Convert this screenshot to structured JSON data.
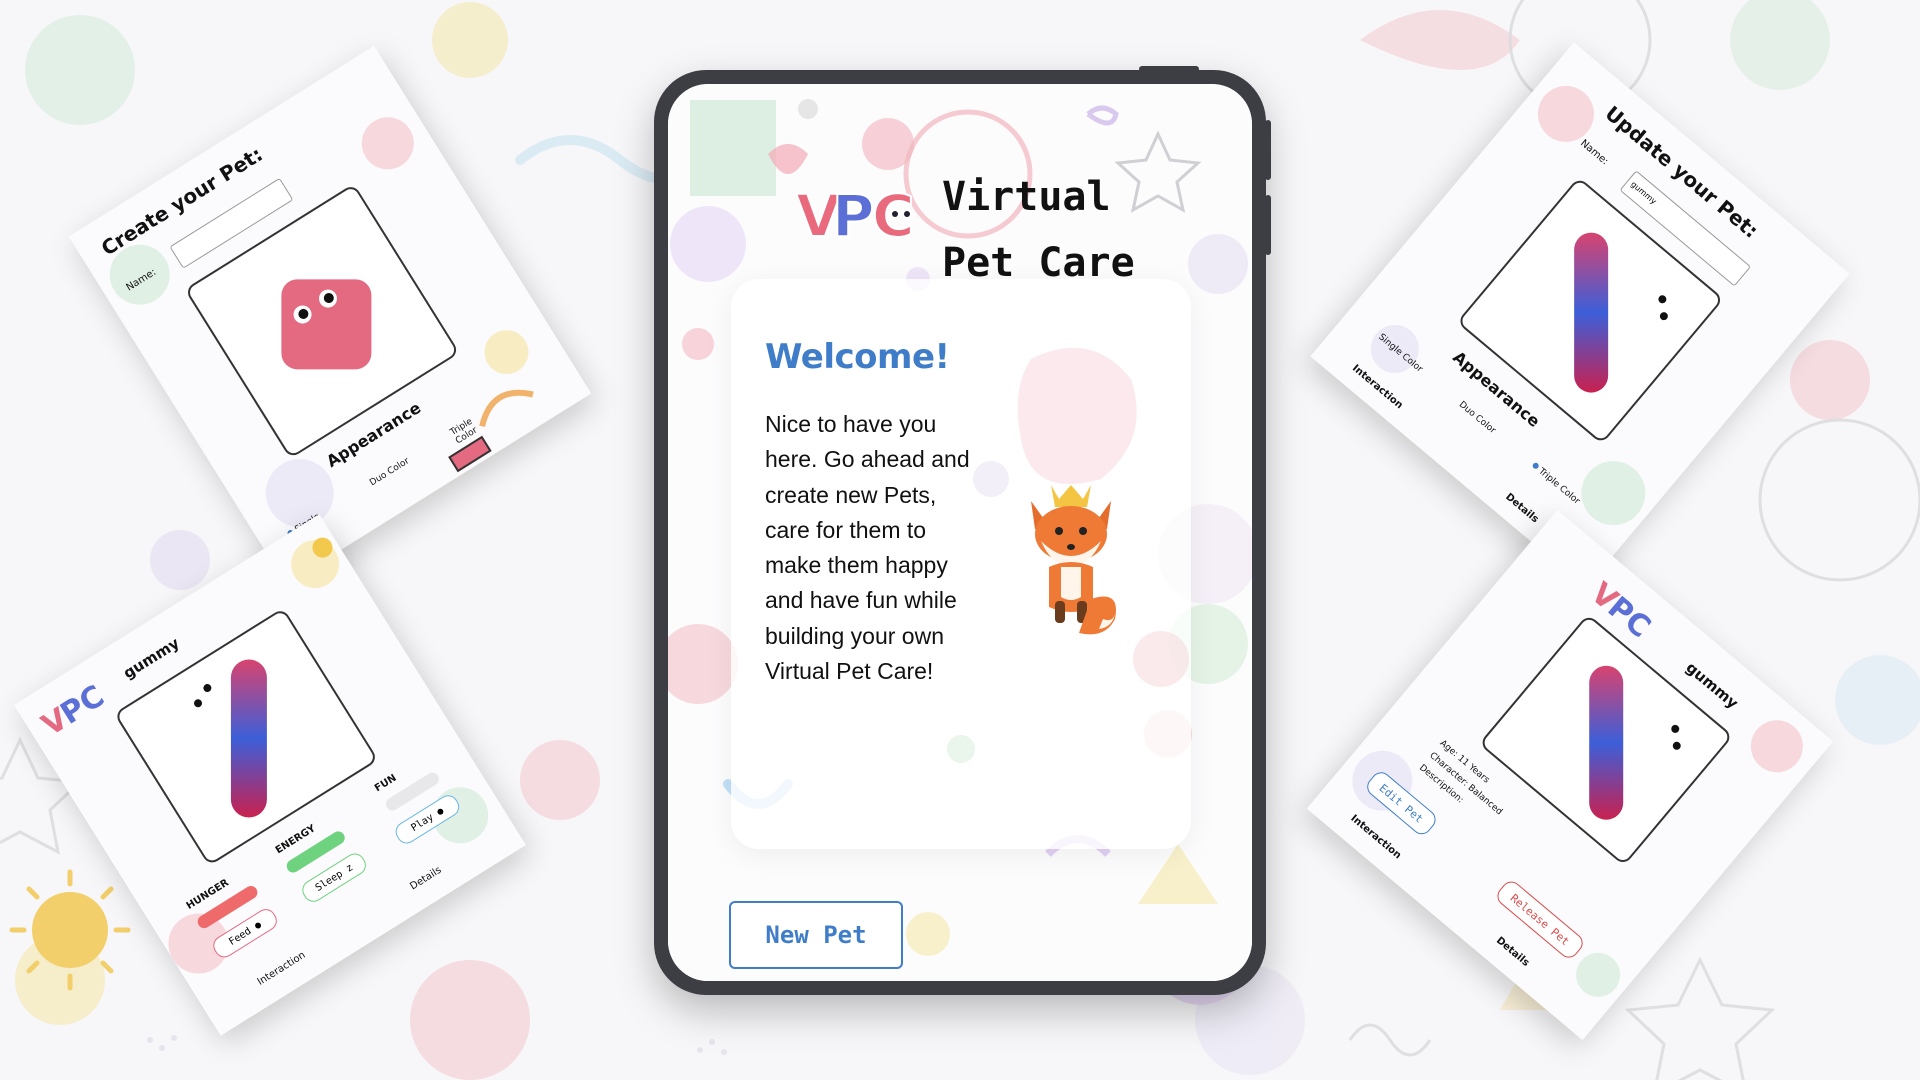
{
  "app": {
    "title_line1": "Virtual",
    "title_line2": "Pet Care",
    "logo_text": "VPC"
  },
  "welcome": {
    "heading": "Welcome!",
    "body": "Nice to have you here. Go ahead and create new Pets, care for them to make them happy and have fun while building your own Virtual Pet Care!",
    "new_pet_label": "New Pet"
  },
  "create_screen": {
    "title": "Create your Pet:",
    "name_label": "Name:",
    "appearance_heading": "Appearance",
    "options": [
      "Single Color",
      "Duo Color",
      "Triple Color"
    ]
  },
  "care_screen": {
    "pet_name": "gummy",
    "stats": [
      "HUNGER",
      "ENERGY",
      "FUN"
    ],
    "actions": [
      "Feed",
      "Sleep",
      "Play"
    ],
    "tabs": [
      "Interaction",
      "Details"
    ]
  },
  "update_screen": {
    "title": "Update your Pet:",
    "name_label": "Name:",
    "name_value": "gummy",
    "appearance_heading": "Appearance",
    "options": [
      "Single Color",
      "Duo Color",
      "Triple Color"
    ],
    "tabs": [
      "Interaction",
      "Details"
    ]
  },
  "details_screen": {
    "pet_name": "gummy",
    "age_label": "Age:",
    "age_value": "11 Years",
    "character_label": "Character:",
    "character_value": "Balanced",
    "description_label": "Description:",
    "edit_label": "Edit Pet",
    "release_label": "Release Pet",
    "tabs": [
      "Interaction",
      "Details"
    ]
  },
  "colors": {
    "accent_blue": "#3f7dc8",
    "release_red": "#d94a4a",
    "pet_pink": "#e46a82",
    "hunger_bar": "#ef6b6b",
    "energy_bar": "#6fd27f"
  },
  "stats_levels": {
    "hunger": 0.8,
    "energy": 0.75,
    "fun": 0.3
  }
}
